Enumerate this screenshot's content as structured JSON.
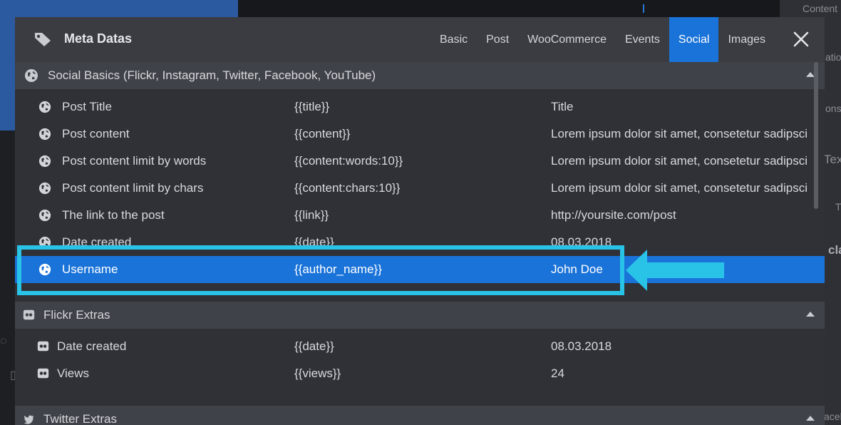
{
  "background": {
    "right_panel_texts": [
      "Content",
      "ation",
      "ons",
      "Tex",
      "T",
      "cla",
      "acel"
    ]
  },
  "modal": {
    "title": "Meta Datas",
    "title_icon": "tag-icon",
    "close_icon": "close-icon",
    "tabs": [
      {
        "label": "Basic",
        "active": false
      },
      {
        "label": "Post",
        "active": false
      },
      {
        "label": "WooCommerce",
        "active": false
      },
      {
        "label": "Events",
        "active": false
      },
      {
        "label": "Social",
        "active": true
      },
      {
        "label": "Images",
        "active": false
      }
    ]
  },
  "sections": {
    "social_basics": {
      "label": "Social Basics (Flickr, Instagram, Twitter, Facebook, YouTube)",
      "icon": "globe-icon",
      "rows": [
        {
          "name": "Post Title",
          "tag": "{{title}}",
          "value": "Title"
        },
        {
          "name": "Post content",
          "tag": "{{content}}",
          "value": "Lorem ipsum dolor sit amet, consetetur sadipscing"
        },
        {
          "name": "Post content limit by words",
          "tag": "{{content:words:10}}",
          "value": "Lorem ipsum dolor sit amet, consetetur sadipscing"
        },
        {
          "name": "Post content limit by chars",
          "tag": "{{content:chars:10}}",
          "value": "Lorem ipsum dolor sit amet, consetetur sadipscing"
        },
        {
          "name": "The link to the post",
          "tag": "{{link}}",
          "value": "http://yoursite.com/post"
        },
        {
          "name": "Date created",
          "tag": "{{date}}",
          "value": "08.03.2018"
        },
        {
          "name": "Username",
          "tag": "{{author_name}}",
          "value": "John Doe"
        }
      ]
    },
    "flickr_extras": {
      "label": "Flickr Extras",
      "icon": "flickr-icon",
      "rows": [
        {
          "name": "Date created",
          "tag": "{{date}}",
          "value": "08.03.2018"
        },
        {
          "name": "Views",
          "tag": "{{views}}",
          "value": "24"
        }
      ]
    },
    "twitter_extras": {
      "label": "Twitter Extras",
      "icon": "twitter-icon"
    }
  },
  "colors": {
    "accent": "#1a73d9",
    "callout": "#29c3e8"
  }
}
